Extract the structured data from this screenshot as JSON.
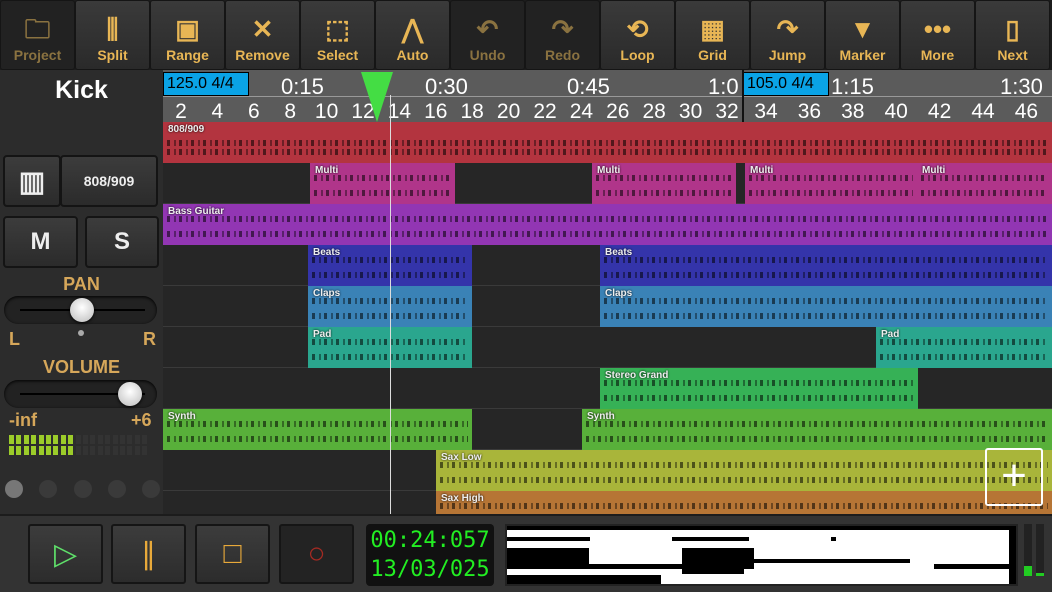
{
  "toolbar": [
    {
      "label": "Project",
      "icon": "folder-icon",
      "glyph": "🗀",
      "enabled": false
    },
    {
      "label": "Split",
      "icon": "split-icon",
      "glyph": "⫼",
      "enabled": true
    },
    {
      "label": "Range",
      "icon": "range-icon",
      "glyph": "▣",
      "enabled": true
    },
    {
      "label": "Remove",
      "icon": "close-icon",
      "glyph": "✕",
      "enabled": true
    },
    {
      "label": "Select",
      "icon": "select-icon",
      "glyph": "⬚",
      "enabled": true
    },
    {
      "label": "Auto",
      "icon": "automation-icon",
      "glyph": "⋀",
      "enabled": true
    },
    {
      "label": "Undo",
      "icon": "undo-icon",
      "glyph": "↶",
      "enabled": false
    },
    {
      "label": "Redo",
      "icon": "redo-icon",
      "glyph": "↷",
      "enabled": false
    },
    {
      "label": "Loop",
      "icon": "loop-icon",
      "glyph": "⟲",
      "enabled": true
    },
    {
      "label": "Grid",
      "icon": "grid-icon",
      "glyph": "▦",
      "enabled": true
    },
    {
      "label": "Jump",
      "icon": "jump-icon",
      "glyph": "↷",
      "enabled": true
    },
    {
      "label": "Marker",
      "icon": "marker-icon",
      "glyph": "▼",
      "enabled": true
    },
    {
      "label": "More",
      "icon": "more-icon",
      "glyph": "•••",
      "enabled": true
    },
    {
      "label": "Next",
      "icon": "next-icon",
      "glyph": "▯",
      "enabled": true
    }
  ],
  "track_panel": {
    "name": "Kick",
    "instrument": "808/909",
    "mute": "M",
    "solo": "S",
    "pan_label": "PAN",
    "pan_left": "L",
    "pan_right": "R",
    "pan_value": 0,
    "volume_label": "VOLUME",
    "vol_min": "-inf",
    "vol_max": "+6",
    "volume_fraction": 0.8,
    "meter_level_fraction": 0.45
  },
  "ruler": {
    "tempos": [
      {
        "text": "125.0  4/4"
      },
      {
        "text": "105.0  4/4"
      }
    ],
    "times": [
      "0:15",
      "0:30",
      "0:45",
      "1:0",
      "1:15",
      "1:30"
    ],
    "bars": [
      "2",
      "4",
      "6",
      "8",
      "10",
      "12",
      "14",
      "16",
      "18",
      "20",
      "22",
      "24",
      "26",
      "28",
      "30",
      "32",
      "34",
      "36",
      "38",
      "40",
      "42",
      "44",
      "46"
    ]
  },
  "tracks": [
    {
      "color": "#b3343f",
      "clips": [
        {
          "name": "808/909",
          "start": 0,
          "end": 889
        }
      ]
    },
    {
      "color": "#b0358a",
      "clips": [
        {
          "name": "Multi",
          "start": 147,
          "end": 292
        },
        {
          "name": "Multi",
          "start": 429,
          "end": 573
        },
        {
          "name": "Multi",
          "start": 582,
          "end": 754
        },
        {
          "name": "Multi",
          "start": 754,
          "end": 889
        }
      ]
    },
    {
      "color": "#9236b3",
      "clips": [
        {
          "name": "Bass Guitar",
          "start": 0,
          "end": 889
        }
      ]
    },
    {
      "color": "#3434aa",
      "clips": [
        {
          "name": "Beats",
          "start": 145,
          "end": 309
        },
        {
          "name": "Beats",
          "start": 437,
          "end": 889
        }
      ]
    },
    {
      "color": "#3a82b6",
      "clips": [
        {
          "name": "Claps",
          "start": 145,
          "end": 309
        },
        {
          "name": "Claps",
          "start": 437,
          "end": 889
        }
      ]
    },
    {
      "color": "#2aa68e",
      "clips": [
        {
          "name": "Pad",
          "start": 145,
          "end": 309
        },
        {
          "name": "Pad",
          "start": 713,
          "end": 889
        }
      ]
    },
    {
      "color": "#36b156",
      "clips": [
        {
          "name": "Stereo Grand",
          "start": 437,
          "end": 755
        }
      ]
    },
    {
      "color": "#58b03a",
      "clips": [
        {
          "name": "Synth",
          "start": 0,
          "end": 309
        },
        {
          "name": "Synth",
          "start": 419,
          "end": 889
        }
      ]
    },
    {
      "color": "#a9b53a",
      "clips": [
        {
          "name": "Sax Low",
          "start": 273,
          "end": 889
        }
      ]
    },
    {
      "color": "#b67535",
      "clips": [
        {
          "name": "Sax High",
          "start": 273,
          "end": 889
        }
      ]
    }
  ],
  "transport": {
    "time": "00:24:057",
    "bars": "13/03/025",
    "play": "play-icon",
    "pause": "pause-icon",
    "stop": "stop-icon",
    "record": "record-icon"
  },
  "colors": {
    "accent": "#e8b655",
    "playhead": "#44dd44",
    "tempo": "#0aa3e6",
    "clock": "#22ee22"
  }
}
